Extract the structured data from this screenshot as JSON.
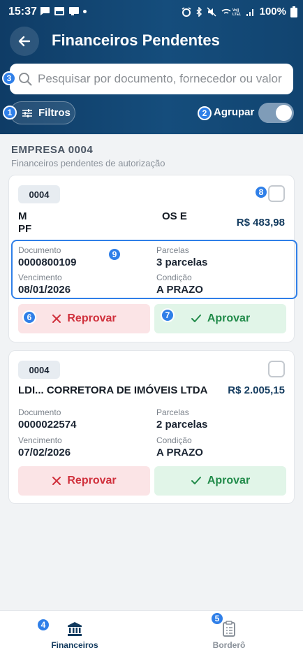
{
  "status_bar": {
    "time": "15:37",
    "battery": "100%"
  },
  "header": {
    "title": "Financeiros Pendentes",
    "search_placeholder": "Pesquisar por documento, fornecedor ou valor",
    "filters_label": "Filtros",
    "group_label": "Agrupar",
    "group_enabled": true
  },
  "company": {
    "title": "EMPRESA 0004",
    "subtitle": "Financeiros pendentes de autorização"
  },
  "cards": [
    {
      "code": "0004",
      "supplier_line1": "M",
      "supplier_line1_end": "OS E",
      "supplier_line2": "PF",
      "amount": "R$ 483,98",
      "doc_label": "Documento",
      "doc_value": "0000800109",
      "parcel_label": "Parcelas",
      "parcel_value": "3 parcelas",
      "due_label": "Vencimento",
      "due_value": "08/01/2026",
      "cond_label": "Condição",
      "cond_value": "A PRAZO",
      "reject_label": "Reprovar",
      "approve_label": "Aprovar"
    },
    {
      "code": "0004",
      "supplier_line1": "LDI... CORRETORA DE IMÓVEIS LTDA",
      "amount": "R$ 2.005,15",
      "doc_label": "Documento",
      "doc_value": "0000022574",
      "parcel_label": "Parcelas",
      "parcel_value": "2 parcelas",
      "due_label": "Vencimento",
      "due_value": "07/02/2026",
      "cond_label": "Condição",
      "cond_value": "A PRAZO",
      "reject_label": "Reprovar",
      "approve_label": "Aprovar"
    }
  ],
  "markers": [
    "1",
    "2",
    "3",
    "4",
    "5",
    "6",
    "7",
    "8",
    "9"
  ],
  "bottom_nav": {
    "items": [
      {
        "label": "Financeiros",
        "active": true
      },
      {
        "label": "Borderô",
        "active": false
      }
    ]
  },
  "colors": {
    "header": "#154d7c",
    "accent": "#2f7fe8",
    "reject": "#d0303c",
    "approve": "#218b4a"
  }
}
